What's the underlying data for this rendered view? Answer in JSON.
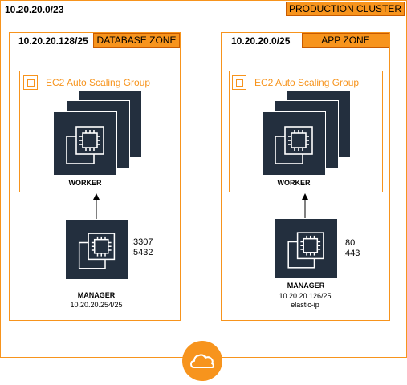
{
  "cluster": {
    "cidr": "10.20.20.0/23",
    "label": "PRODUCTION CLUSTER"
  },
  "database_zone": {
    "cidr": "10.20.20.128/25",
    "zone_label": "DATABASE ZONE",
    "asg_title": "EC2 Auto Scaling Group",
    "worker_label": "WORKER",
    "manager_label": "MANAGER",
    "manager_ip": "10.20.20.254/25",
    "ports": [
      ":3307",
      ":5432"
    ]
  },
  "app_zone": {
    "cidr": "10.20.20.0/25",
    "zone_label": "APP ZONE",
    "asg_title": "EC2 Auto Scaling Group",
    "worker_label": "WORKER",
    "manager_label": "MANAGER",
    "manager_ip": "10.20.20.126/25",
    "manager_extra": "elastic-ip",
    "ports": [
      ":80",
      ":443"
    ]
  },
  "icons": {
    "asg": "auto-scaling-group-icon",
    "ec2": "ec2-instance-icon",
    "internet": "cloud-icon"
  },
  "colors": {
    "accent": "#f7941d",
    "tile": "#232f3e"
  }
}
